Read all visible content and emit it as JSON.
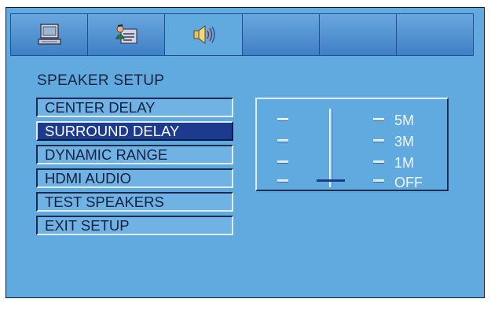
{
  "tabs": [
    {
      "icon": "computer-icon",
      "active": false
    },
    {
      "icon": "settings-person-icon",
      "active": false
    },
    {
      "icon": "speaker-icon",
      "active": true
    },
    {
      "icon": "",
      "active": false
    },
    {
      "icon": "",
      "active": false
    },
    {
      "icon": "",
      "active": false
    }
  ],
  "page_title": "SPEAKER SETUP",
  "menu": {
    "items": [
      {
        "label": "CENTER DELAY",
        "selected": false
      },
      {
        "label": "SURROUND DELAY",
        "selected": true
      },
      {
        "label": "DYNAMIC RANGE",
        "selected": false
      },
      {
        "label": "HDMI AUDIO",
        "selected": false
      },
      {
        "label": "TEST SPEAKERS",
        "selected": false
      },
      {
        "label": "EXIT SETUP",
        "selected": false
      }
    ]
  },
  "delay_panel": {
    "options": [
      "5M",
      "3M",
      "1M",
      "OFF"
    ],
    "selected": "OFF"
  },
  "colors": {
    "background": "#60aadf",
    "selection": "#1c3a8e",
    "text_dark": "#13213f",
    "text_light": "#f2f8ff"
  }
}
